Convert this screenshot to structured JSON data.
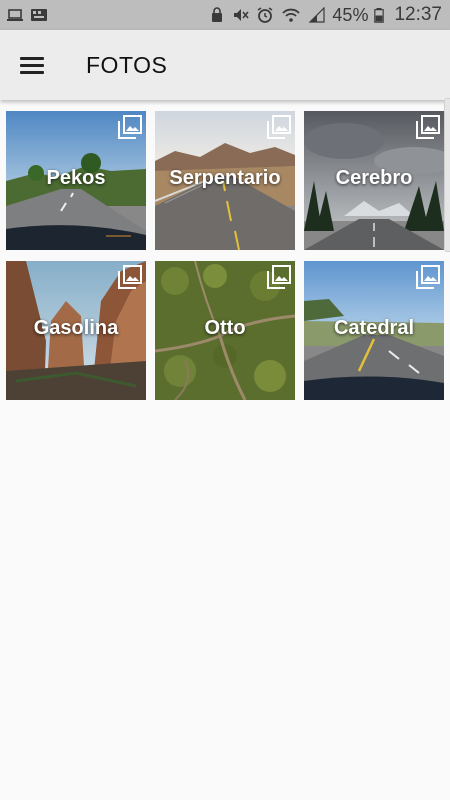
{
  "status_bar": {
    "battery_percent": "45%",
    "time": "12:37",
    "icons": [
      "laptop-icon",
      "keyboard-icon",
      "lock-icon",
      "mute-icon",
      "alarm-icon",
      "wifi-icon",
      "signal-icon",
      "battery-icon"
    ]
  },
  "app_bar": {
    "menu_icon": "hamburger-menu-icon",
    "title": "FOTOS"
  },
  "albums": [
    {
      "name": "Pekos",
      "icon": "gallery-icon"
    },
    {
      "name": "Serpentario",
      "icon": "gallery-icon"
    },
    {
      "name": "Cerebro",
      "icon": "gallery-icon"
    },
    {
      "name": "Gasolina",
      "icon": "gallery-icon"
    },
    {
      "name": "Otto",
      "icon": "gallery-icon"
    },
    {
      "name": "Catedral",
      "icon": "gallery-icon"
    }
  ]
}
